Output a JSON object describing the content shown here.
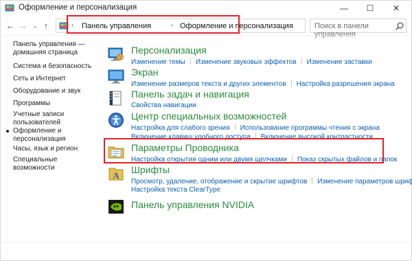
{
  "window": {
    "title": "Оформление и персонализация",
    "buttons": {
      "minimize": "—",
      "maximize": "☐",
      "close": "✕"
    }
  },
  "nav": {
    "back": "←",
    "forward": "→",
    "recent": "⌄",
    "up": "↑"
  },
  "address": {
    "sep": "›",
    "crumbs": [
      "Панель управления",
      "Оформление и персонализация"
    ],
    "dropdown": "⌄",
    "refresh": "⟳"
  },
  "search": {
    "placeholder": "Поиск в панели управления",
    "icon": "search-icon"
  },
  "sidebar": {
    "items": [
      {
        "label_line1": "Панель управления —",
        "label_line2": "домашняя страница"
      },
      {
        "label": "Система и безопасность"
      },
      {
        "label": "Сеть и Интернет"
      },
      {
        "label": "Оборудование и звук"
      },
      {
        "label": "Программы"
      },
      {
        "label_line1": "Учетные записи",
        "label_line2": "пользователей"
      },
      {
        "label_line1": "Оформление и",
        "label_line2": "персонализация",
        "active": true
      },
      {
        "label": "Часы, язык и регион"
      },
      {
        "label": "Специальные возможности"
      }
    ]
  },
  "groups": [
    {
      "title": "Персонализация",
      "icon": "personalization-icon",
      "links": [
        "Изменение темы",
        "Изменение звуковых эффектов",
        "Изменение заставки"
      ]
    },
    {
      "title": "Экран",
      "icon": "display-icon",
      "links": [
        "Изменение размеров текста и других элементов",
        "Настройка разрешения экрана"
      ]
    },
    {
      "title": "Панель задач и навигация",
      "icon": "taskbar-icon",
      "links": [
        "Свойства навигации"
      ]
    },
    {
      "title": "Центр специальных возможностей",
      "icon": "ease-of-access-icon",
      "links": [
        "Настройка для слабого зрения",
        "Использование программы чтения с экрана"
      ],
      "links2": [
        "Включение клавиш удобного доступа",
        "Включение высокой контрастности"
      ]
    },
    {
      "title": "Параметры Проводника",
      "icon": "folder-options-icon",
      "links": [
        "Настройка открытия одним или двумя щелчками",
        "Показ скрытых файлов и папок"
      ]
    },
    {
      "title": "Шрифты",
      "icon": "fonts-icon",
      "links": [
        "Просмотр, удаление, отображение и скрытие шрифтов",
        "Изменение параметров шрифта"
      ],
      "links2": [
        "Настройка текста ClearType"
      ]
    },
    {
      "title": "Панель управления NVIDIA",
      "icon": "nvidia-icon",
      "links": []
    }
  ]
}
